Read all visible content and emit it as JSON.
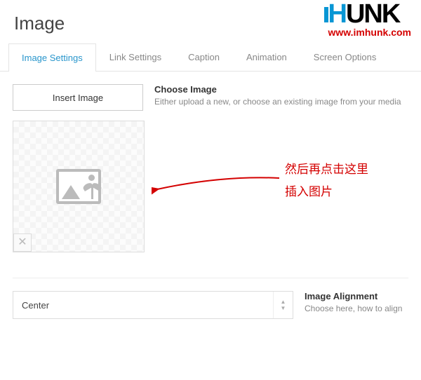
{
  "header": {
    "title": "Image"
  },
  "logo": {
    "brand": "HUNK",
    "url": "www.imhunk.com"
  },
  "tabs": [
    {
      "label": "Image Settings",
      "active": true
    },
    {
      "label": "Link Settings",
      "active": false
    },
    {
      "label": "Caption",
      "active": false
    },
    {
      "label": "Animation",
      "active": false
    },
    {
      "label": "Screen Options",
      "active": false
    }
  ],
  "insert": {
    "button": "Insert Image",
    "title": "Choose Image",
    "desc": "Either upload a new, or choose an existing image from your media"
  },
  "annotation": {
    "line1": "然后再点击这里",
    "line2": "插入图片"
  },
  "alignment": {
    "value": "Center",
    "title": "Image Alignment",
    "desc": "Choose here, how to align"
  },
  "colors": {
    "accent": "#2996cc",
    "danger": "#d40000"
  }
}
